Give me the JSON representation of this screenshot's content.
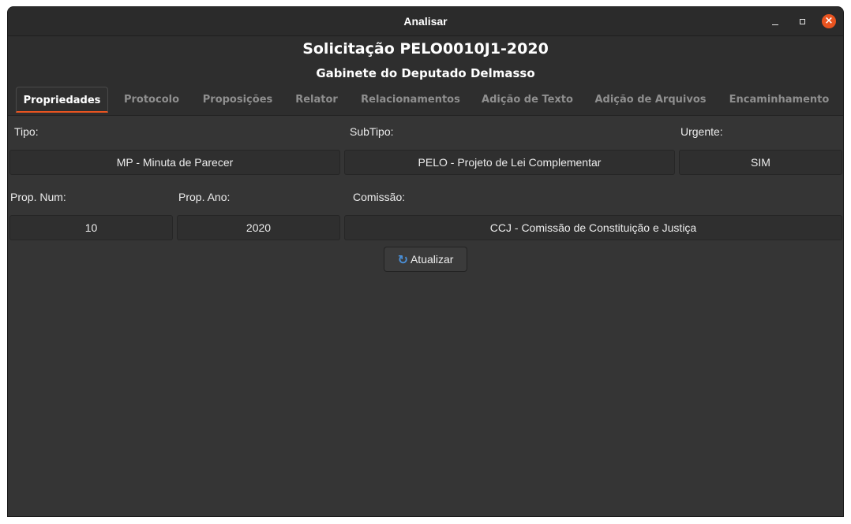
{
  "window": {
    "title": "Analisar",
    "close_color": "#e95420"
  },
  "header": {
    "title": "Solicitação PELO0010J1-2020",
    "subtitle": "Gabinete do Deputado Delmasso"
  },
  "tabs": [
    {
      "label": "Propriedades",
      "active": true
    },
    {
      "label": "Protocolo"
    },
    {
      "label": "Proposições"
    },
    {
      "label": "Relator"
    },
    {
      "label": "Relacionamentos"
    },
    {
      "label": "Adição de Texto"
    },
    {
      "label": "Adição de Arquivos"
    },
    {
      "label": "Encaminhamento"
    }
  ],
  "form": {
    "tipo_label": "Tipo:",
    "tipo_value": "MP - Minuta de Parecer",
    "subtipo_label": "SubTipo:",
    "subtipo_value": "PELO - Projeto de Lei Complementar",
    "urgente_label": "Urgente:",
    "urgente_value": "SIM",
    "prop_num_label": "Prop. Num:",
    "prop_num_value": "10",
    "prop_ano_label": "Prop. Ano:",
    "prop_ano_value": "2020",
    "comissao_label": "Comissão:",
    "comissao_value": "CCJ - Comissão de Constituição e Justiça"
  },
  "actions": {
    "refresh_label": "Atualizar",
    "refresh_icon": "refresh-icon"
  }
}
